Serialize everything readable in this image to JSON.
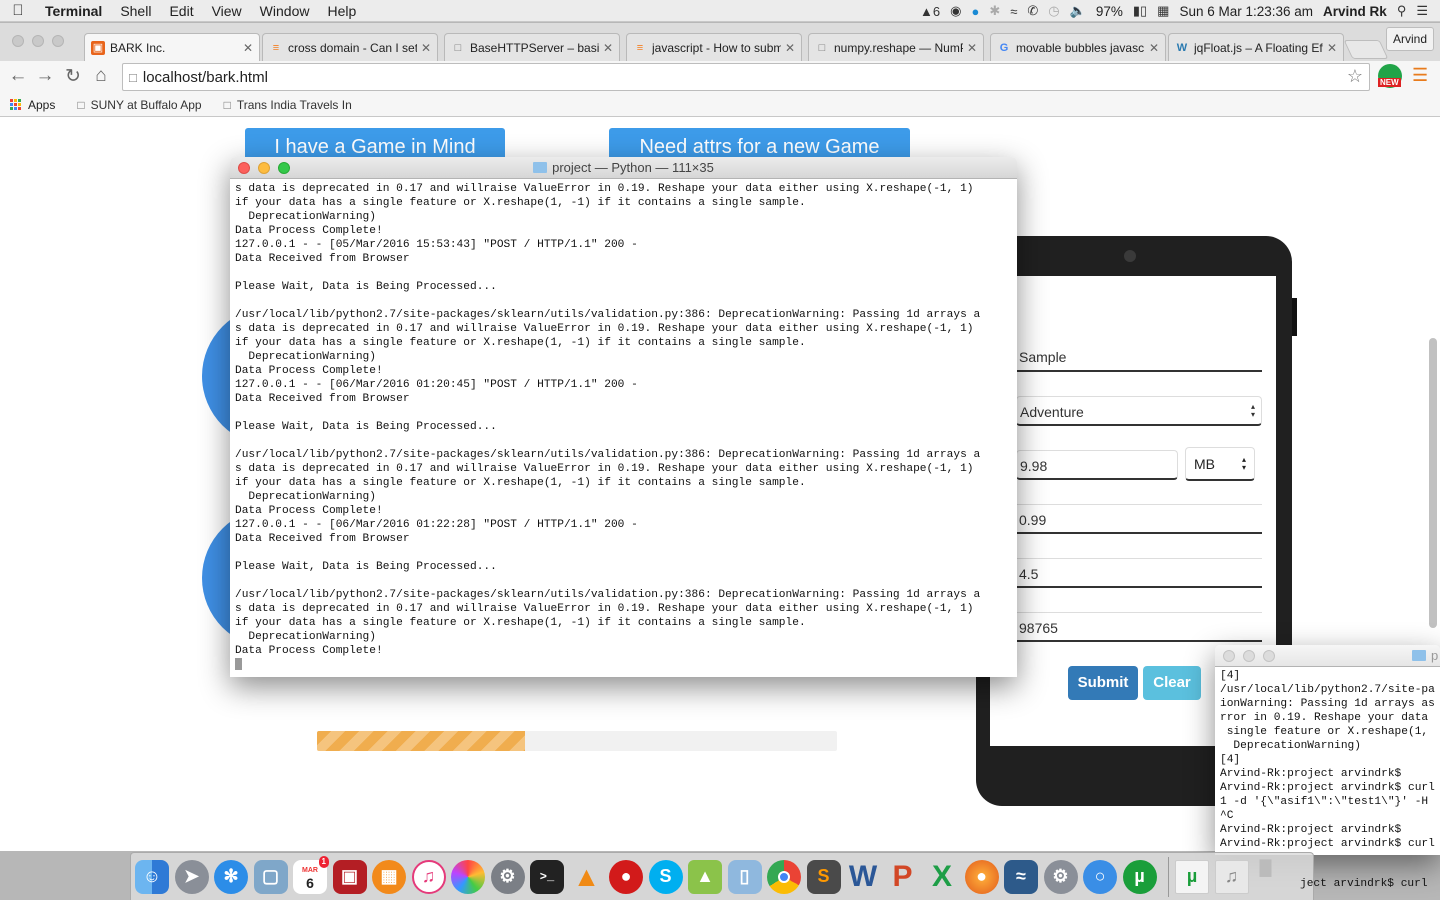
{
  "menubar": {
    "app": "Terminal",
    "items": [
      "Shell",
      "Edit",
      "View",
      "Window",
      "Help"
    ],
    "status": {
      "badge_count": "6",
      "battery": "97%",
      "datetime": "Sun 6 Mar  1:23:36 am",
      "user": "Arvind Rk"
    }
  },
  "browser": {
    "tabs": [
      {
        "title": "BARK Inc.",
        "icon": "bark-icon"
      },
      {
        "title": "cross domain - Can I set",
        "icon": "stackoverflow-icon"
      },
      {
        "title": "BaseHTTPServer – basic",
        "icon": "page-icon"
      },
      {
        "title": "javascript - How to subm",
        "icon": "stackoverflow-icon"
      },
      {
        "title": "numpy.reshape — NumP",
        "icon": "page-icon"
      },
      {
        "title": "movable bubbles javasc",
        "icon": "google-icon"
      },
      {
        "title": "jqFloat.js – A Floating Ef",
        "icon": "wordpress-icon"
      }
    ],
    "profile": "Arvind",
    "url": "localhost/bark.html",
    "bookmarks": {
      "apps": "Apps",
      "items": [
        "SUNY at Buffalo App",
        "Trans India Travels In"
      ]
    }
  },
  "page": {
    "buttons": {
      "game_in_mind": "I have a Game in Mind",
      "need_attrs": "Need attrs for a new Game"
    },
    "progress": 0.4,
    "form": {
      "name": "Sample",
      "genre": "Adventure",
      "size": "9.98",
      "size_unit": "MB",
      "price": "0.99",
      "rating": "4.5",
      "reviews": "98765",
      "submit": "Submit",
      "clear": "Clear"
    }
  },
  "terminal_main": {
    "title": "project — Python — 111×35",
    "output": "s data is deprecated in 0.17 and willraise ValueError in 0.19. Reshape your data either using X.reshape(-1, 1)\nif your data has a single feature or X.reshape(1, -1) if it contains a single sample.\n  DeprecationWarning)\nData Process Complete!\n127.0.0.1 - - [05/Mar/2016 15:53:43] \"POST / HTTP/1.1\" 200 -\nData Received from Browser\n\nPlease Wait, Data is Being Processed...\n\n/usr/local/lib/python2.7/site-packages/sklearn/utils/validation.py:386: DeprecationWarning: Passing 1d arrays a\ns data is deprecated in 0.17 and willraise ValueError in 0.19. Reshape your data either using X.reshape(-1, 1)\nif your data has a single feature or X.reshape(1, -1) if it contains a single sample.\n  DeprecationWarning)\nData Process Complete!\n127.0.0.1 - - [06/Mar/2016 01:20:45] \"POST / HTTP/1.1\" 200 -\nData Received from Browser\n\nPlease Wait, Data is Being Processed...\n\n/usr/local/lib/python2.7/site-packages/sklearn/utils/validation.py:386: DeprecationWarning: Passing 1d arrays a\ns data is deprecated in 0.17 and willraise ValueError in 0.19. Reshape your data either using X.reshape(-1, 1)\nif your data has a single feature or X.reshape(1, -1) if it contains a single sample.\n  DeprecationWarning)\nData Process Complete!\n127.0.0.1 - - [06/Mar/2016 01:22:28] \"POST / HTTP/1.1\" 200 -\nData Received from Browser\n\nPlease Wait, Data is Being Processed...\n\n/usr/local/lib/python2.7/site-packages/sklearn/utils/validation.py:386: DeprecationWarning: Passing 1d arrays a\ns data is deprecated in 0.17 and willraise ValueError in 0.19. Reshape your data either using X.reshape(-1, 1)\nif your data has a single feature or X.reshape(1, -1) if it contains a single sample.\n  DeprecationWarning)\nData Process Complete!"
  },
  "terminal_second": {
    "title": "p",
    "output": "[4]\n/usr/local/lib/python2.7/site-pa\nionWarning: Passing 1d arrays as\nrror in 0.19. Reshape your data\n single feature or X.reshape(1,\n  DeprecationWarning)\n[4]\nArvind-Rk:project arvindrk$\nArvind-Rk:project arvindrk$ curl\n1 -d '{\\\"asif1\\\":\\\"test1\\\"}' -H\n^C\nArvind-Rk:project arvindrk$\nArvind-Rk:project arvindrk$ curl",
    "peek": "ject arvindrk$ curl"
  },
  "dock": {
    "calendar_month": "MAR",
    "calendar_day": "6",
    "calendar_badge": "1",
    "apps": [
      "finder-icon",
      "launchpad-icon",
      "safari-icon",
      "preview-icon",
      "calendar-icon",
      "photo-booth-icon",
      "ibooks-icon",
      "itunes-icon",
      "photos-icon",
      "system-preferences-icon",
      "terminal-icon",
      "vlc-icon",
      "red-icon",
      "skype-icon",
      "android-icon",
      "virtualbox-icon",
      "chrome-icon",
      "sublime-text-icon",
      "word-icon",
      "powerpoint-icon",
      "excel-icon",
      "firefox-icon",
      "mysql-workbench-icon",
      "system-preferences-icon",
      "messages-icon",
      "utorrent-icon",
      "torrent-file-icon",
      "music-icon",
      "trash-icon"
    ]
  },
  "colors": {
    "accent": "#3d9be9",
    "submit": "#337ab7",
    "clear": "#5bc0de",
    "progress": "#f0ad4e"
  }
}
